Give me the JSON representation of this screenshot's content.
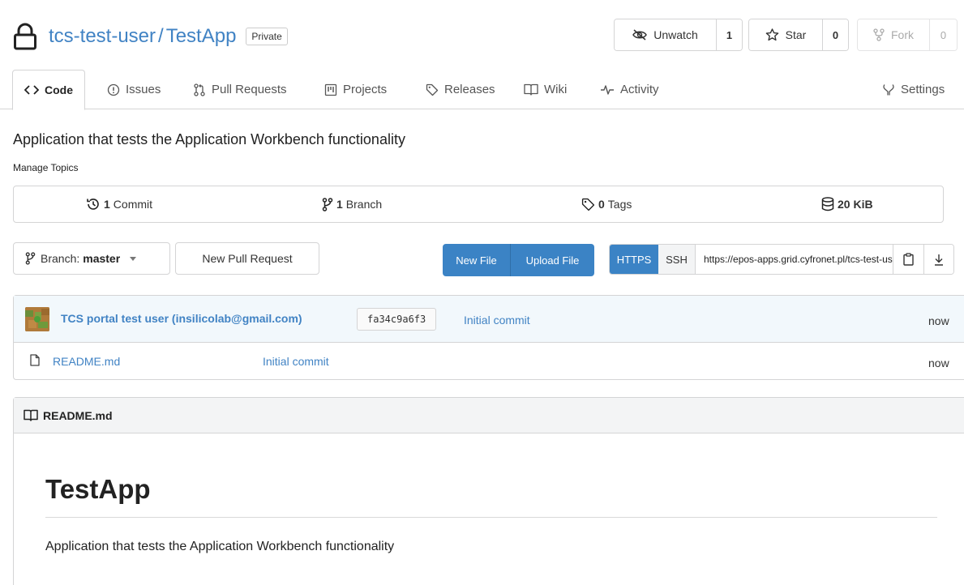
{
  "repo": {
    "owner": "tcs-test-user",
    "separator": "/",
    "name": "TestApp",
    "visibility": "Private"
  },
  "actions": {
    "watch": {
      "label": "Unwatch",
      "count": "1"
    },
    "star": {
      "label": "Star",
      "count": "0"
    },
    "fork": {
      "label": "Fork",
      "count": "0"
    }
  },
  "tabs": {
    "code": "Code",
    "issues": "Issues",
    "pull_requests": "Pull Requests",
    "projects": "Projects",
    "releases": "Releases",
    "wiki": "Wiki",
    "activity": "Activity",
    "settings": "Settings"
  },
  "description": "Application that tests the Application Workbench functionality",
  "manage_topics": "Manage Topics",
  "stats": {
    "commits": {
      "count": "1",
      "label": "Commit"
    },
    "branches": {
      "count": "1",
      "label": "Branch"
    },
    "tags": {
      "count": "0",
      "label": "Tags"
    },
    "size": "20 KiB"
  },
  "toolbar": {
    "branch_prefix": "Branch:",
    "branch_name": "master",
    "new_pull_request": "New Pull Request",
    "new_file": "New File",
    "upload_file": "Upload File",
    "clone_https": "HTTPS",
    "clone_ssh": "SSH",
    "clone_url": "https://epos-apps.grid.cyfronet.pl/tcs-test-user/TestApp.git"
  },
  "last_commit": {
    "author": "TCS portal test user (insilicolab@gmail.com)",
    "sha": "fa34c9a6f3",
    "message": "Initial commit",
    "time": "now"
  },
  "files": [
    {
      "name": "README.md",
      "message": "Initial commit",
      "time": "now"
    }
  ],
  "readme": {
    "header": "README.md",
    "heading": "TestApp",
    "body": "Application that tests the Application Workbench functionality"
  },
  "colors": {
    "link": "#4183c4",
    "primary_button": "#3b83c5",
    "commit_bar_bg": "#f2f8fc",
    "border": "#d4d4d5"
  }
}
